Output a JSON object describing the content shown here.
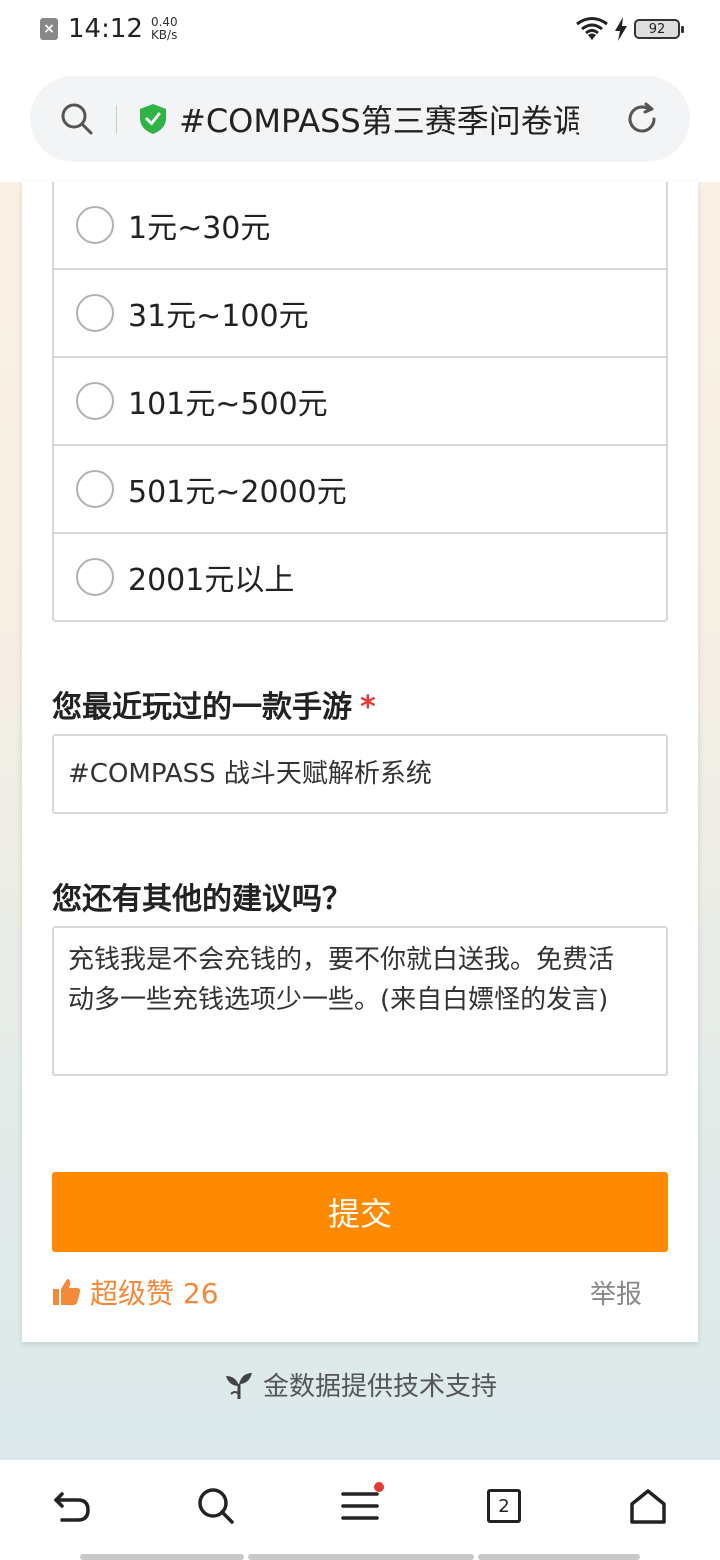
{
  "status_bar": {
    "time": "14:12",
    "net_speed_value": "0.40",
    "net_speed_unit": "KB/s",
    "battery": "92"
  },
  "address_bar": {
    "title": "#COMPASS第三赛季问卷调查"
  },
  "question_spend": {
    "options": [
      "1元~30元",
      "31元~100元",
      "101元~500元",
      "501元~2000元",
      "2001元以上"
    ]
  },
  "question_game": {
    "title": "您最近玩过的一款手游",
    "required_mark": "*",
    "value": "#COMPASS 战斗天赋解析系统"
  },
  "question_suggestion": {
    "title": "您还有其他的建议吗？",
    "value_line1": "充钱我是不会充钱的，要不你就白送我。免费活",
    "value_line2": "动多一些充钱选项少一些。(来自白嫖怪的发言)"
  },
  "form": {
    "submit_label": "提交",
    "like_label": "超级赞 26",
    "report_label": "举报"
  },
  "footer": {
    "tech_support": "金数据提供技术支持"
  },
  "bottom_nav": {
    "tab_count": "2"
  },
  "colors": {
    "accent": "#ff8a00",
    "like": "#f5893a",
    "required": "#e53935",
    "secure": "#2fb344"
  }
}
